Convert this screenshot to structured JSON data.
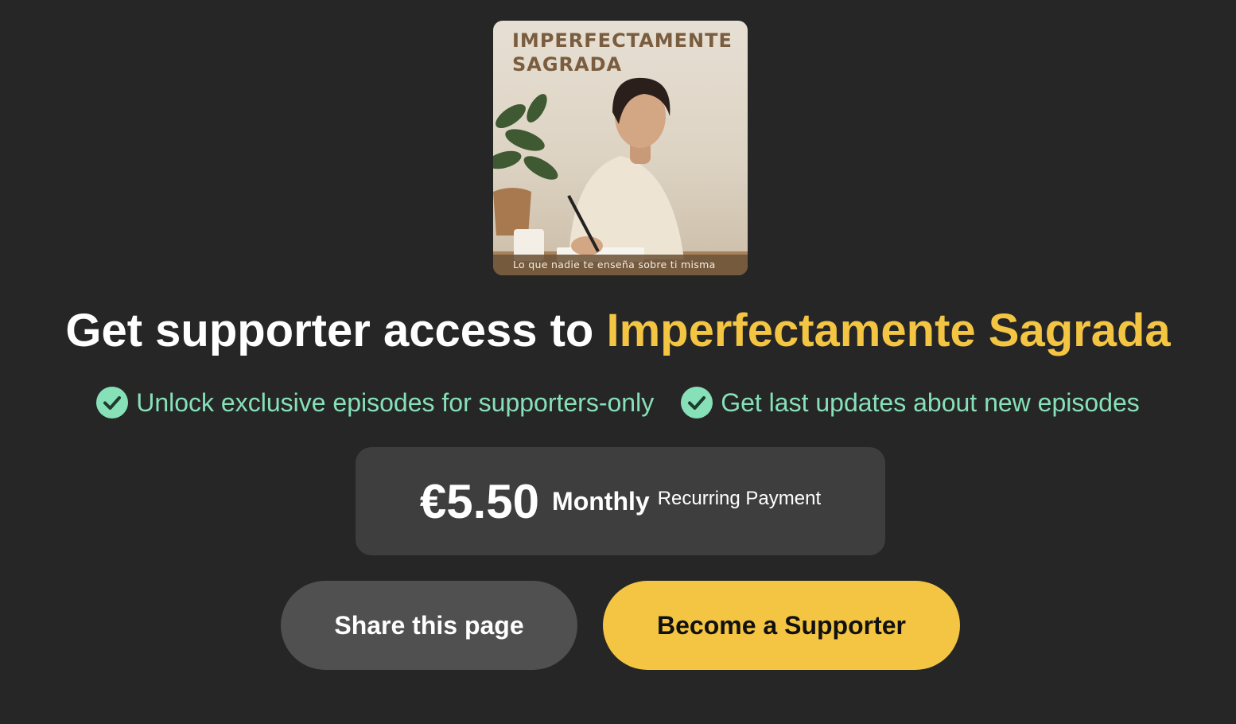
{
  "cover": {
    "title": "IMPERFECTAMENTE\nSAGRADA",
    "caption": "Lo que nadie te enseña sobre ti misma"
  },
  "heading": {
    "prefix": "Get supporter access to ",
    "podcast_name": "Imperfectamente Sagrada"
  },
  "features": [
    {
      "label": "Unlock exclusive episodes for supporters-only",
      "icon": "check-circle-icon"
    },
    {
      "label": "Get last updates about new episodes",
      "icon": "check-circle-icon"
    }
  ],
  "price": {
    "amount": "€5.50",
    "frequency": "Monthly",
    "note": "Recurring Payment"
  },
  "buttons": {
    "share_label": "Share this page",
    "support_label": "Become a Supporter"
  },
  "colors": {
    "background": "#262626",
    "accent": "#f4c542",
    "feature_text": "#86e0b8",
    "check_fill": "#86e0b8",
    "price_box": "#3e3e3e",
    "share_button": "#505050"
  }
}
